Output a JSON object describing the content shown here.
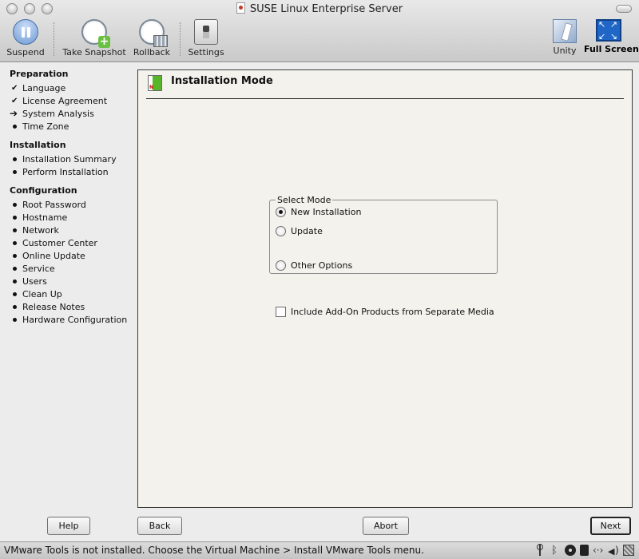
{
  "window": {
    "title": "SUSE Linux Enterprise Server"
  },
  "toolbar": {
    "suspend": "Suspend",
    "take_snapshot": "Take Snapshot",
    "rollback": "Rollback",
    "settings": "Settings",
    "unity": "Unity",
    "full_screen": "Full Screen"
  },
  "sidebar": {
    "sections": [
      {
        "title": "Preparation",
        "items": [
          {
            "label": "Language",
            "state": "done"
          },
          {
            "label": "License Agreement",
            "state": "done"
          },
          {
            "label": "System Analysis",
            "state": "current"
          },
          {
            "label": "Time Zone",
            "state": "pending"
          }
        ]
      },
      {
        "title": "Installation",
        "items": [
          {
            "label": "Installation Summary",
            "state": "pending"
          },
          {
            "label": "Perform Installation",
            "state": "pending"
          }
        ]
      },
      {
        "title": "Configuration",
        "items": [
          {
            "label": "Root Password",
            "state": "pending"
          },
          {
            "label": "Hostname",
            "state": "pending"
          },
          {
            "label": "Network",
            "state": "pending"
          },
          {
            "label": "Customer Center",
            "state": "pending"
          },
          {
            "label": "Online Update",
            "state": "pending"
          },
          {
            "label": "Service",
            "state": "pending"
          },
          {
            "label": "Users",
            "state": "pending"
          },
          {
            "label": "Clean Up",
            "state": "pending"
          },
          {
            "label": "Release Notes",
            "state": "pending"
          },
          {
            "label": "Hardware Configuration",
            "state": "pending"
          }
        ]
      }
    ]
  },
  "main": {
    "title": "Installation Mode",
    "select_mode": {
      "label": "Select Mode",
      "options": [
        {
          "label": "New Installation",
          "selected": true
        },
        {
          "label": "Update",
          "selected": false
        },
        {
          "label": "Other Options",
          "selected": false
        }
      ]
    },
    "addon_checkbox": {
      "label": "Include Add-On Products from Separate Media",
      "checked": false
    }
  },
  "buttons": {
    "help": "Help",
    "back": "Back",
    "abort": "Abort",
    "next": "Next"
  },
  "statusbar": {
    "message": "VMware Tools is not installed. Choose the Virtual Machine > Install VMware Tools menu."
  }
}
